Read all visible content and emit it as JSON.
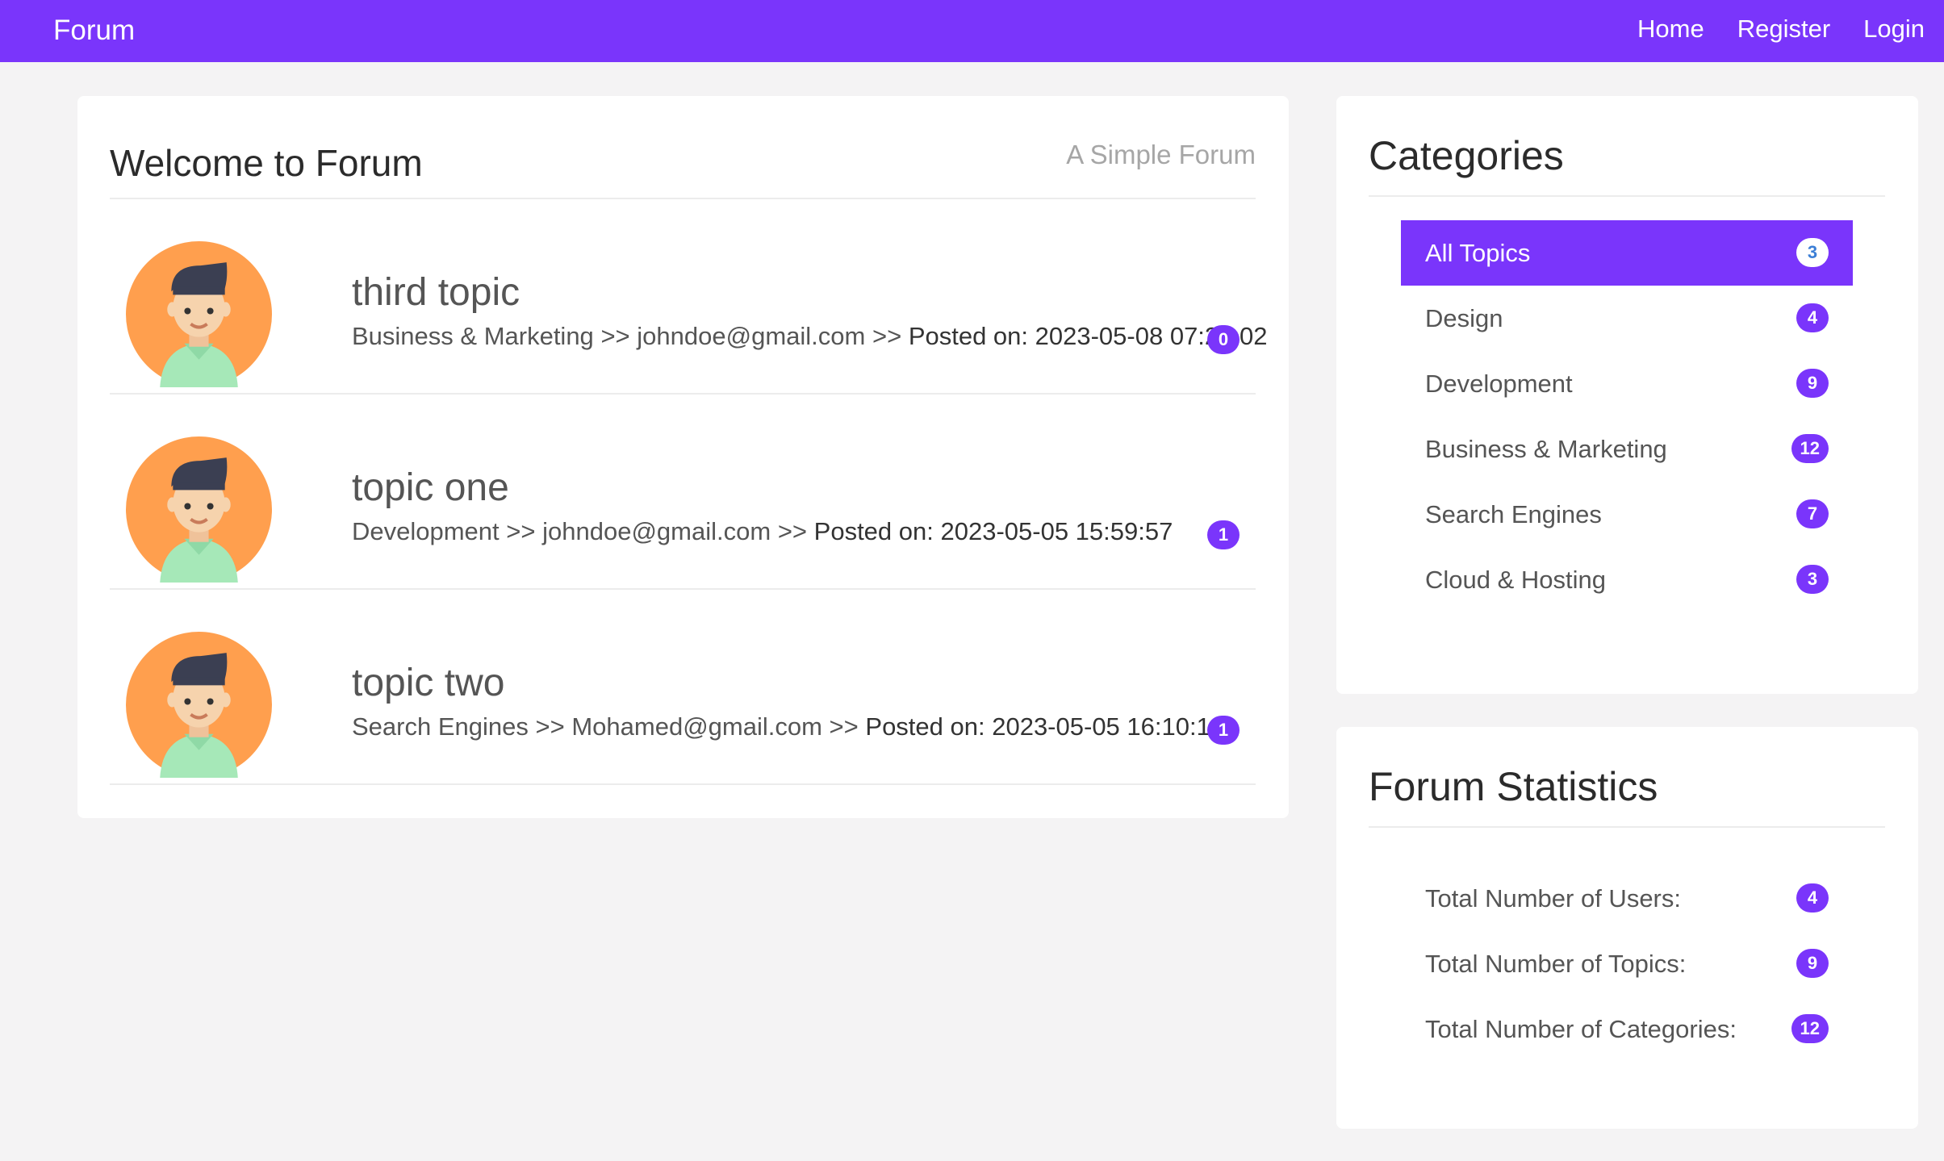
{
  "navbar": {
    "brand": "Forum",
    "links": [
      "Home",
      "Register",
      "Login"
    ],
    "color": "#7a35fb"
  },
  "main": {
    "title": "Welcome to Forum",
    "subtitle": "A Simple Forum",
    "topics": [
      {
        "title": "third topic",
        "category": "Business & Marketing",
        "author": "johndoe@gmail.com",
        "posted": "Posted on: 2023-05-08 07:29:02",
        "replies": "0"
      },
      {
        "title": "topic one",
        "category": "Development",
        "author": "johndoe@gmail.com",
        "posted": "Posted on: 2023-05-05 15:59:57",
        "replies": "1"
      },
      {
        "title": "topic two",
        "category": "Search Engines",
        "author": "Mohamed@gmail.com",
        "posted": "Posted on: 2023-05-05 16:10:14",
        "replies": "1"
      }
    ]
  },
  "categories": {
    "title": "Categories",
    "items": [
      {
        "label": "All Topics",
        "count": "3",
        "active": true
      },
      {
        "label": "Design",
        "count": "4"
      },
      {
        "label": "Development",
        "count": "9"
      },
      {
        "label": "Business & Marketing",
        "count": "12"
      },
      {
        "label": "Search Engines",
        "count": "7"
      },
      {
        "label": "Cloud & Hosting",
        "count": "3"
      }
    ]
  },
  "stats": {
    "title": "Forum Statistics",
    "items": [
      {
        "label": "Total Number of Users:",
        "count": "4"
      },
      {
        "label": "Total Number of Topics:",
        "count": "9"
      },
      {
        "label": "Total Number of Categories:",
        "count": "12"
      }
    ]
  },
  "separator": ">>"
}
